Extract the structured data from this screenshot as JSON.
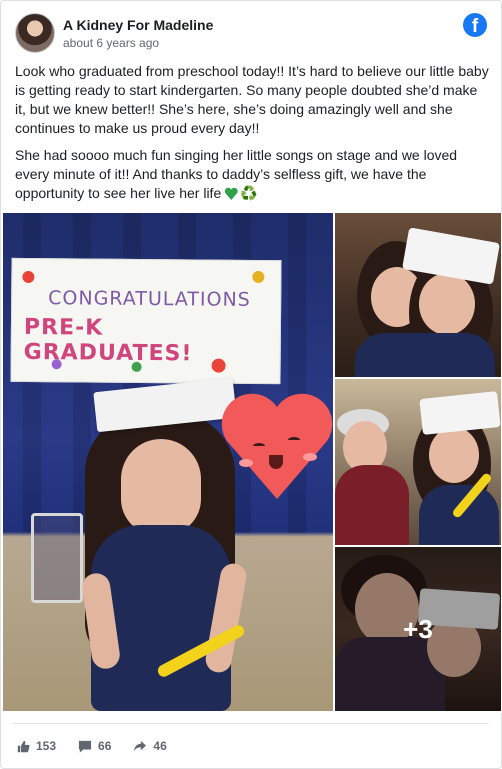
{
  "post": {
    "page_name": "A Kidney For Madeline",
    "timestamp": "about 6 years ago",
    "paragraph1": "Look who graduated from preschool today!! It’s hard to believe our little baby is getting ready to start kindergarten. So many people doubted she’d make it, but we knew better!! She’s here, she’s doing amazingly well and she continues to make us proud every day!!",
    "paragraph2": "She had soooo much fun singing her little songs on stage and we loved every minute of it!! And thanks to daddy’s selfless gift, we have the opportunity to see her live her life",
    "emoji_recycle": "♻️"
  },
  "photo": {
    "banner_line1": "CONGRATULATIONS",
    "banner_line2": "PRE-K GRADUATES!"
  },
  "gallery": {
    "more_count": "+3"
  },
  "footer": {
    "likes": "153",
    "comments": "66",
    "shares": "46"
  },
  "icons": {
    "logo": "facebook-logo-icon",
    "like": "thumbs-up-icon",
    "comment": "comment-bubble-icon",
    "share": "share-arrow-icon",
    "heart": "green-heart-emoji",
    "recycle": "recycle-emoji"
  },
  "colors": {
    "facebook_blue": "#1877f2",
    "secondary_text": "#606770",
    "heart_emoji": "#31a24c"
  }
}
